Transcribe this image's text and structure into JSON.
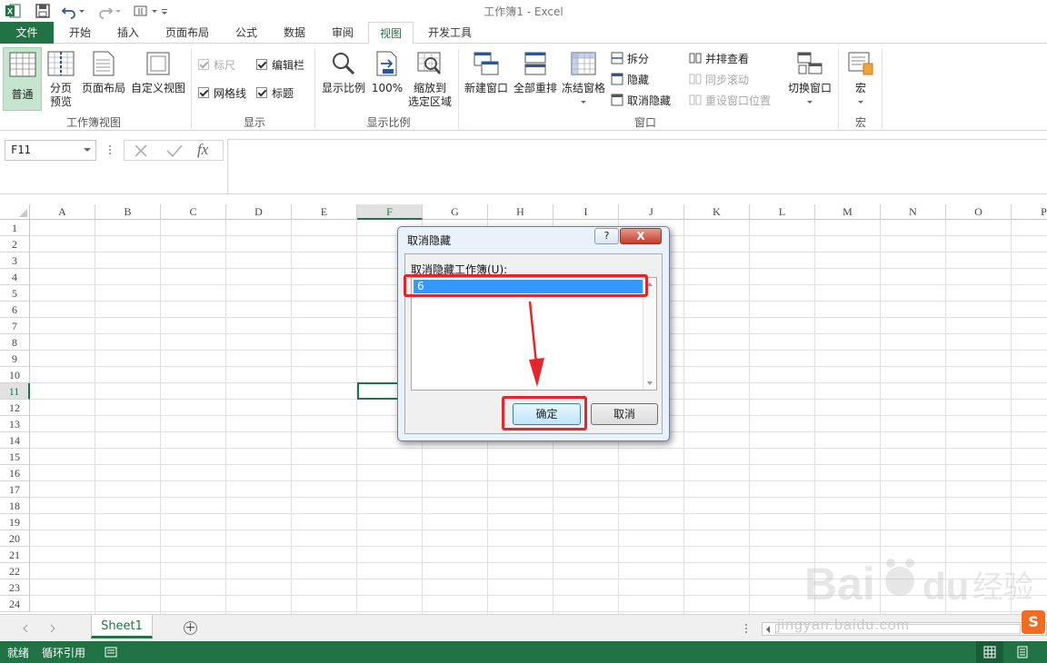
{
  "window": {
    "title": "工作簿1 - Excel"
  },
  "menu_tabs": [
    {
      "label": "文件"
    },
    {
      "label": "开始"
    },
    {
      "label": "插入"
    },
    {
      "label": "页面布局"
    },
    {
      "label": "公式"
    },
    {
      "label": "数据"
    },
    {
      "label": "审阅"
    },
    {
      "label": "视图"
    },
    {
      "label": "开发工具"
    }
  ],
  "active_tab": "视图",
  "ribbon": {
    "workbook_views": {
      "label": "工作簿视图",
      "normal": "普通",
      "page_break_1": "分页",
      "page_break_2": "预览",
      "page_layout": "页面布局",
      "custom_views": "自定义视图"
    },
    "show": {
      "label": "显示",
      "ruler": "标尺",
      "formula_bar": "编辑栏",
      "gridlines": "网格线",
      "headings": "标题"
    },
    "zoom": {
      "label": "显示比例",
      "zoom": "显示比例",
      "hundred": "100%",
      "zoom_sel_1": "缩放到",
      "zoom_sel_2": "选定区域"
    },
    "window": {
      "label": "窗口",
      "new_window": "新建窗口",
      "arrange_all": "全部重排",
      "freeze_panes": "冻结窗格",
      "split": "拆分",
      "hide": "隐藏",
      "unhide": "取消隐藏",
      "side_by_side": "并排查看",
      "sync_scroll": "同步滚动",
      "reset_position": "重设窗口位置",
      "switch_windows": "切换窗口"
    },
    "macros": {
      "label": "宏",
      "macros": "宏"
    }
  },
  "formula_bar": {
    "name_box": "F11",
    "fx": "fx"
  },
  "columns": [
    "A",
    "B",
    "C",
    "D",
    "E",
    "F",
    "G",
    "H",
    "I",
    "J",
    "K",
    "L",
    "M",
    "N",
    "O",
    "P"
  ],
  "selected_column": "F",
  "rows": [
    "1",
    "2",
    "3",
    "4",
    "5",
    "6",
    "7",
    "8",
    "9",
    "10",
    "11",
    "12",
    "13",
    "14",
    "15",
    "16",
    "17",
    "18",
    "19",
    "20",
    "21",
    "22",
    "23",
    "24"
  ],
  "selected_row": "11",
  "sheet_tabs": [
    {
      "label": "Sheet1"
    }
  ],
  "add_sheet": "+",
  "status_bar": {
    "ready": "就绪",
    "circular_ref": "循环引用"
  },
  "dialog": {
    "title": "取消隐藏",
    "help": "?",
    "close": "X",
    "list_label": "取消隐藏工作簿(U):",
    "list_items": [
      "6"
    ],
    "ok": "确定",
    "cancel": "取消"
  },
  "watermark": {
    "text": "jingyan.baidu.com"
  },
  "colors": {
    "excel_green": "#217346",
    "highlight_red": "#e4262b",
    "selection_blue": "#3399ff"
  }
}
